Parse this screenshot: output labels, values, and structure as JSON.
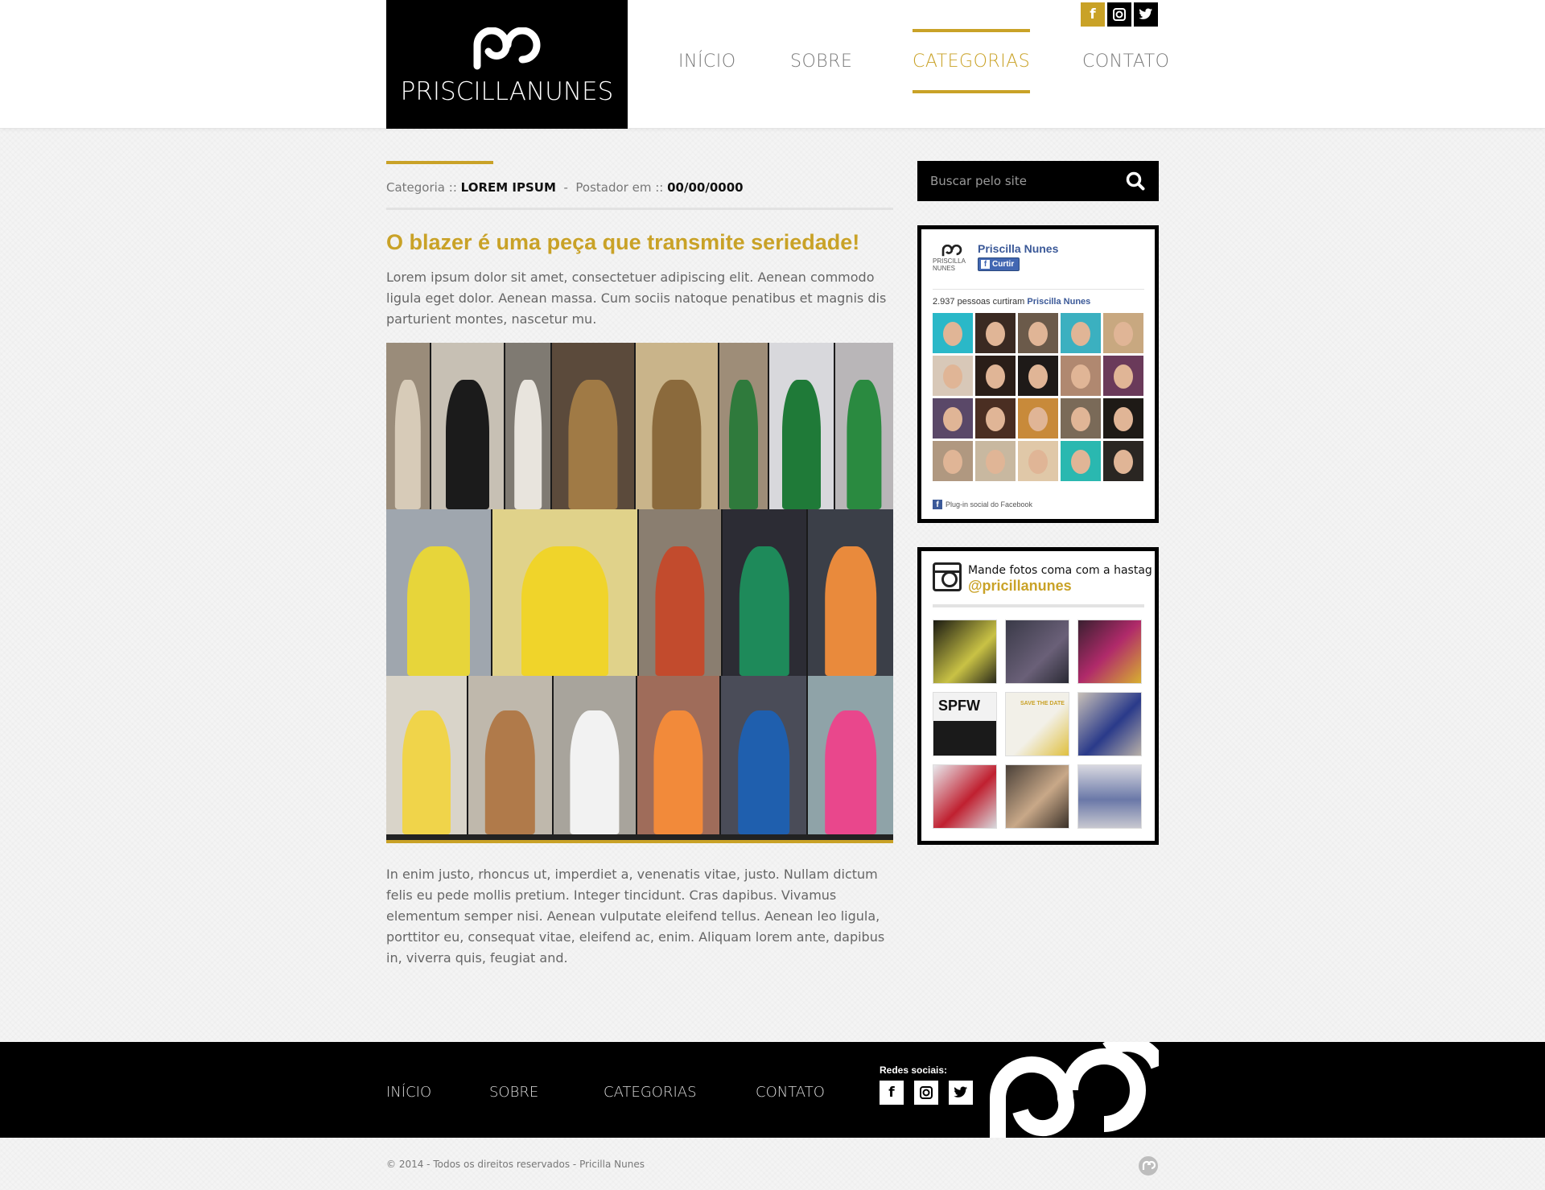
{
  "brand": {
    "logo_text": "PRISCILLANUNES",
    "accent_color": "#c9a227"
  },
  "header": {
    "social": [
      "facebook-icon",
      "instagram-icon",
      "twitter-icon"
    ],
    "nav": [
      {
        "label": "INÍCIO",
        "active": false
      },
      {
        "label": "SOBRE",
        "active": false
      },
      {
        "label": "CATEGORIAS",
        "active": true
      },
      {
        "label": "CONTATO",
        "active": false
      }
    ]
  },
  "article": {
    "meta": {
      "category_label": "Categoria ::",
      "category_value": "LOREM IPSUM",
      "separator": "-",
      "posted_label": "Postador em ::",
      "posted_value": "00/00/0000"
    },
    "title": "O blazer é uma peça que transmite seriedade!",
    "intro": "Lorem ipsum dolor sit amet, consectetuer adipiscing elit. Aenean commodo ligula eget dolor. Aenean massa. Cum sociis natoque penatibus et magnis dis parturient montes, nascetur mu.",
    "body": "In enim justo, rhoncus ut, imperdiet a, venenatis vitae, justo. Nullam dictum felis eu pede mollis pretium. Integer tincidunt. Cras dapibus. Vivamus elementum semper nisi. Aenean vulputate eleifend tellus. Aenean leo ligula, porttitor eu, consequat vitae, eleifend ac, enim. Aliquam lorem ante, dapibus in, viverra quis, feugiat and."
  },
  "sidebar": {
    "search": {
      "placeholder": "Buscar pelo site"
    },
    "facebook": {
      "page_name": "Priscilla Nunes",
      "logo_caption": "PRISCILLA NUNES",
      "like_button": "Curtir",
      "likes_count": "2.937 pessoas curtiram",
      "likes_page": "Priscilla Nunes",
      "plugin_text": "Plug-in social do Facebook"
    },
    "instagram": {
      "headline": "Mande fotos coma com a hastag",
      "handle": "@pricillanunes",
      "photo_labels": [
        "",
        "",
        "",
        "SPFW",
        "SAVE THE DATE",
        "",
        "",
        "",
        ""
      ]
    }
  },
  "footer": {
    "nav": [
      "INÍCIO",
      "SOBRE",
      "CATEGORIAS",
      "CONTATO"
    ],
    "social_label": "Redes sociais:",
    "copyright": "© 2014 - Todos os direitos reservados - Pricilla Nunes"
  }
}
